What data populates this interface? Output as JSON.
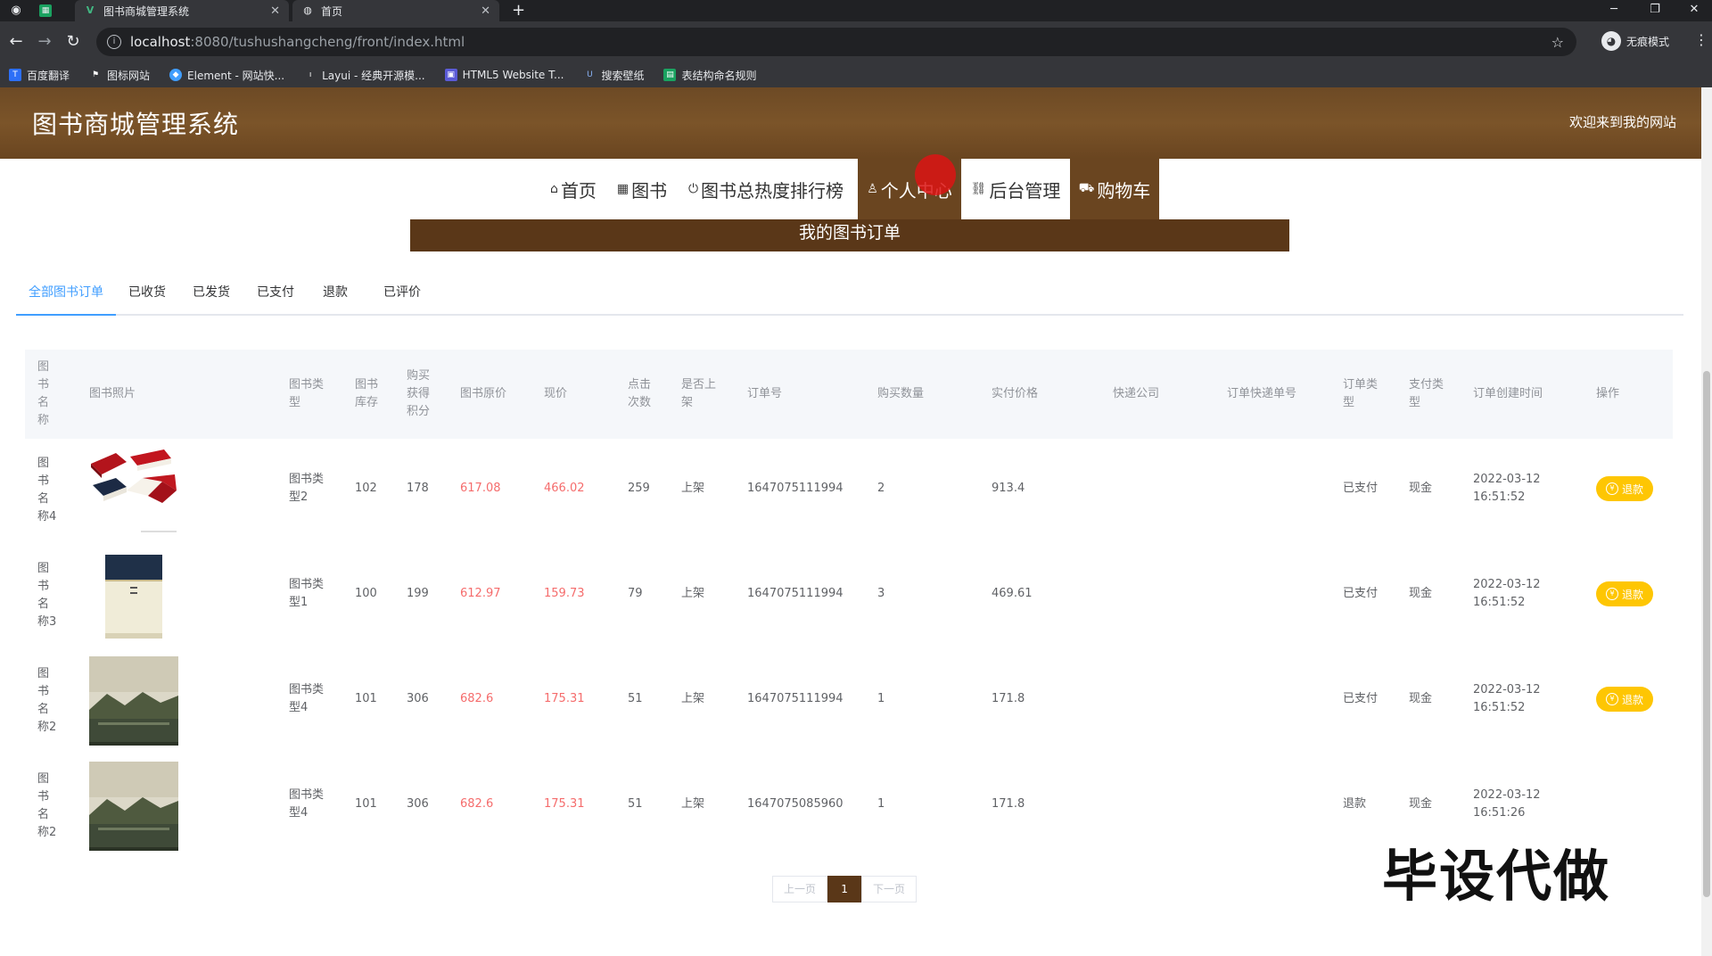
{
  "browser": {
    "tabs": [
      {
        "title": "图书商城管理系统"
      },
      {
        "title": "首页"
      }
    ],
    "url_host": "localhost",
    "url_path": ":8080/tushushangcheng/front/index.html",
    "incognito_label": "无痕模式",
    "bookmarks": [
      "百度翻译",
      "图标网站",
      "Element - 网站快...",
      "Layui - 经典开源模...",
      "HTML5 Website T...",
      "搜索壁纸",
      "表结构命名规则"
    ]
  },
  "site": {
    "title": "图书商城管理系统",
    "welcome": "欢迎来到我的网站"
  },
  "nav": {
    "items": [
      "首页",
      "图书",
      "图书总热度排行榜",
      "个人中心",
      "后台管理",
      "购物车"
    ]
  },
  "banner": "我的图书订单",
  "subtabs": [
    "全部图书订单",
    "已收货",
    "已发货",
    "已支付",
    "退款",
    "已评价"
  ],
  "table": {
    "headers": {
      "name": "图书名称",
      "photo": "图书照片",
      "type": "图书类型",
      "stock": "图书库存",
      "points": "购买获得积分",
      "orig_price": "图书原价",
      "price": "现价",
      "clicks": "点击次数",
      "onshelf": "是否上架",
      "order_no": "订单号",
      "qty": "购买数量",
      "paid": "实付价格",
      "courier": "快递公司",
      "tracking": "订单快递单号",
      "order_type": "订单类型",
      "pay_type": "支付类型",
      "created": "订单创建时间",
      "action": "操作"
    },
    "rows": [
      {
        "name": "图书名称4",
        "type": "图书类型2",
        "stock": "102",
        "points": "178",
        "orig_price": "617.08",
        "price": "466.02",
        "clicks": "259",
        "onshelf": "上架",
        "order_no": "1647075111994",
        "qty": "2",
        "paid": "913.4",
        "order_type": "已支付",
        "pay_type": "现金",
        "created_date": "2022-03-12",
        "created_time": "16:51:52",
        "action": "退款"
      },
      {
        "name": "图书名称3",
        "type": "图书类型1",
        "stock": "100",
        "points": "199",
        "orig_price": "612.97",
        "price": "159.73",
        "clicks": "79",
        "onshelf": "上架",
        "order_no": "1647075111994",
        "qty": "3",
        "paid": "469.61",
        "order_type": "已支付",
        "pay_type": "现金",
        "created_date": "2022-03-12",
        "created_time": "16:51:52",
        "action": "退款"
      },
      {
        "name": "图书名称2",
        "type": "图书类型4",
        "stock": "101",
        "points": "306",
        "orig_price": "682.6",
        "price": "175.31",
        "clicks": "51",
        "onshelf": "上架",
        "order_no": "1647075111994",
        "qty": "1",
        "paid": "171.8",
        "order_type": "已支付",
        "pay_type": "现金",
        "created_date": "2022-03-12",
        "created_time": "16:51:52",
        "action": "退款"
      },
      {
        "name": "图书名称2",
        "type": "图书类型4",
        "stock": "101",
        "points": "306",
        "orig_price": "682.6",
        "price": "175.31",
        "clicks": "51",
        "onshelf": "上架",
        "order_no": "1647075085960",
        "qty": "1",
        "paid": "171.8",
        "order_type": "退款",
        "pay_type": "现金",
        "created_date": "2022-03-12",
        "created_time": "16:51:26"
      }
    ]
  },
  "pagination": {
    "prev": "上一页",
    "current": "1",
    "next": "下一页"
  },
  "watermark": "毕设代做",
  "colors": {
    "header_brown": "#6d4a25",
    "active_brown": "#6a4520",
    "banner_brown": "#5a3718",
    "tab_blue": "#409eff",
    "price_red": "#f56c6c",
    "refund_yellow": "#fec603"
  }
}
